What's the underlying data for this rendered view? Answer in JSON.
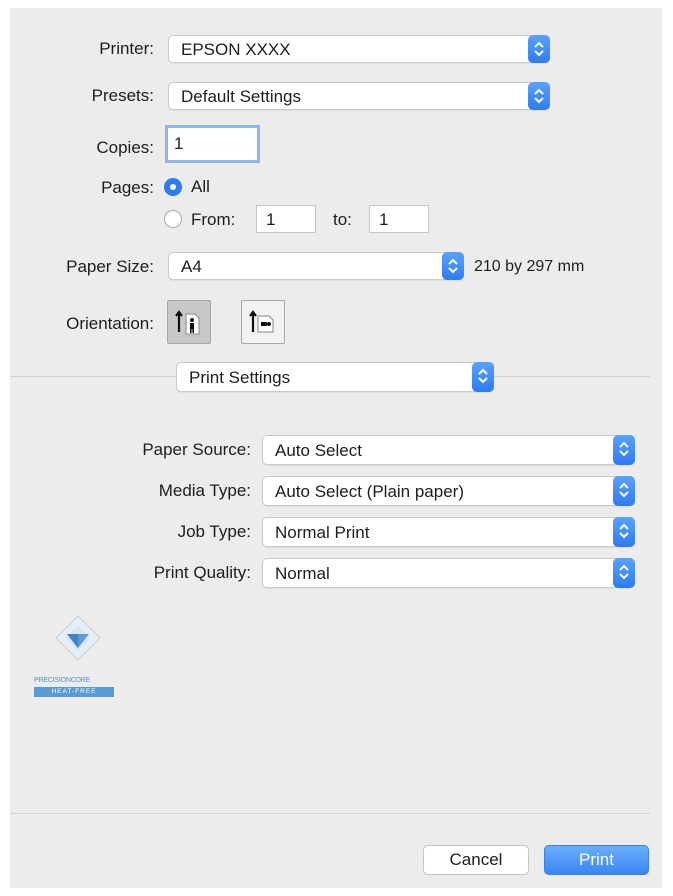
{
  "printer": {
    "label": "Printer:",
    "value": "EPSON XXXX"
  },
  "presets": {
    "label": "Presets:",
    "value": "Default Settings"
  },
  "copies": {
    "label": "Copies:",
    "value": "1"
  },
  "pages": {
    "label": "Pages:",
    "all_label": "All",
    "from_label": "From:",
    "from_value": "1",
    "to_label": "to:",
    "to_value": "1",
    "selected": "All"
  },
  "paper_size": {
    "label": "Paper Size:",
    "value": "A4",
    "dimensions": "210 by 297 mm"
  },
  "orientation": {
    "label": "Orientation:",
    "options": [
      "portrait",
      "landscape"
    ],
    "selected": "portrait"
  },
  "section_menu": {
    "value": "Print Settings"
  },
  "print_settings": {
    "paper_source": {
      "label": "Paper Source:",
      "value": "Auto Select"
    },
    "media_type": {
      "label": "Media Type:",
      "value": "Auto Select (Plain paper)"
    },
    "job_type": {
      "label": "Job Type:",
      "value": "Normal Print"
    },
    "print_quality": {
      "label": "Print Quality:",
      "value": "Normal"
    }
  },
  "logo": {
    "line1": "PRECISIONCORE",
    "line2": "HEAT-FREE"
  },
  "footer": {
    "cancel_label": "Cancel",
    "print_label": "Print"
  },
  "colors": {
    "accent": "#2f7bf0",
    "background": "#ececec"
  }
}
